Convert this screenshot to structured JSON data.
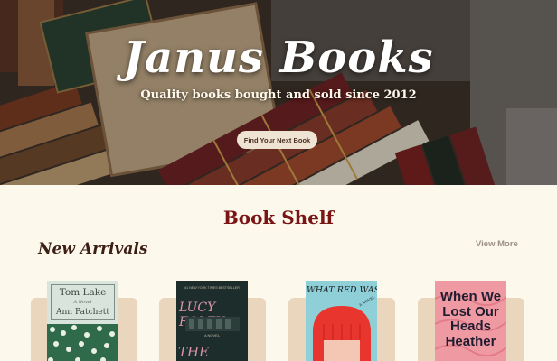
{
  "hero": {
    "title": "Janus Books",
    "subtitle": "Quality books bought and sold since 2012",
    "cta_label": "Find Your Next Book"
  },
  "shelf": {
    "title": "Book Shelf",
    "section_title": "New Arrivals",
    "view_more_label": "View More"
  },
  "books": [
    {
      "title": "Tom Lake",
      "subtitle": "A Novel",
      "author": "Ann Patchett"
    },
    {
      "top_line": "#1 NEW YORK TIMES BESTSELLER",
      "author": "LUCY FOLEY",
      "subtitle": "A NOVEL",
      "title": "THE PARIS"
    },
    {
      "title": "WHAT RED WAS",
      "subtitle": "A NOVEL"
    },
    {
      "title": "When We Lost Our Heads Heather"
    }
  ],
  "colors": {
    "page_background": "#fdf8ec",
    "heading_red": "#7a1515",
    "section_title": "#3b1e14",
    "card_background": "#ead6bc",
    "cta_background": "#efe3d3",
    "link_grey": "#9a8f86"
  }
}
